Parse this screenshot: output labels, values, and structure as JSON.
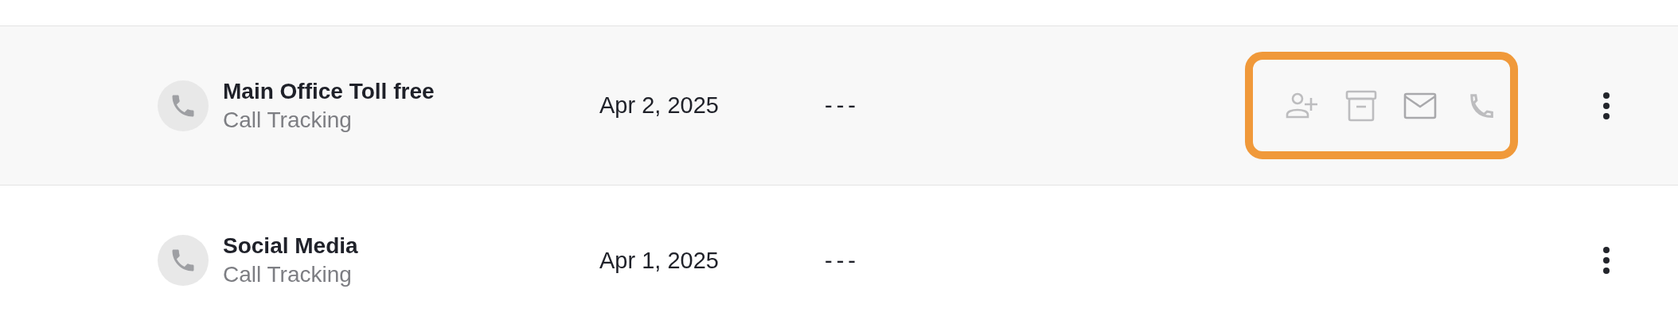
{
  "rows": [
    {
      "name": "Main Office Toll free",
      "source": "Call Tracking",
      "date": "Apr 2, 2025",
      "column_4": "---",
      "hovered": true,
      "actions_highlighted": true
    },
    {
      "name": "Social Media",
      "source": "Call Tracking",
      "date": "Apr 1, 2025",
      "column_4": "---",
      "hovered": false
    }
  ]
}
